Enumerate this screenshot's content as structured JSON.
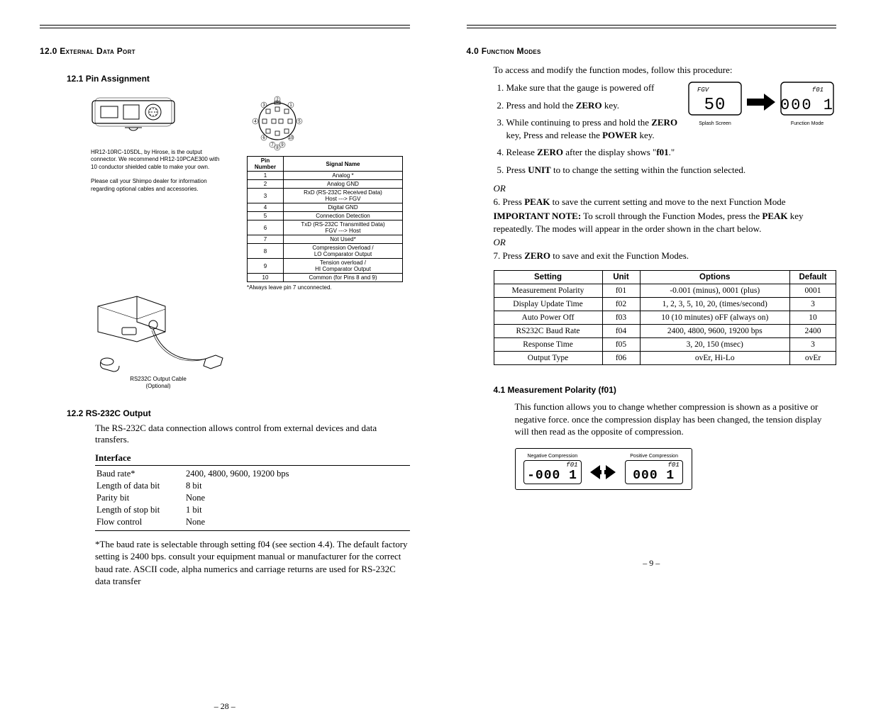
{
  "left": {
    "heading": "12.0 External Data Port",
    "sub1": "12.1 Pin Assignment",
    "connector_note1": "HR12-10RC-10SDL, by Hirose, is the output connector. We recommend HR12-10PCAE300 with 10 conductor shielded cable to make your own.",
    "connector_note2": "Please call your Shimpo dealer for information regarding optional cables and accessories.",
    "pin_header": {
      "num": "Pin Number",
      "sig": "Signal Name"
    },
    "pins": [
      {
        "n": "1",
        "s": "Analog *"
      },
      {
        "n": "2",
        "s": "Analog GND"
      },
      {
        "n": "3",
        "s": "RxD (RS-232C Received Data)\nHost ---> FGV"
      },
      {
        "n": "4",
        "s": "Digital GND"
      },
      {
        "n": "5",
        "s": "Connection Detection"
      },
      {
        "n": "6",
        "s": "TxD (RS-232C Transmitted Data)\nFGV ---> Host"
      },
      {
        "n": "7",
        "s": "Not Used*"
      },
      {
        "n": "8",
        "s": "Compression Overload /\nLO Comparator Output"
      },
      {
        "n": "9",
        "s": "Tension overload /\nHI Comparator Output"
      },
      {
        "n": "10",
        "s": "Common (for Pins 8 and 9)"
      }
    ],
    "pin_footnote": "*Always leave pin 7 unconnected.",
    "cable_caption1": "RS232C Output Cable",
    "cable_caption2": "(Optional)",
    "sub2": "12.2 RS-232C Output",
    "rs_intro": "The RS-232C data connection allows control from external devices and data transfers.",
    "iface_title": "Interface",
    "iface_rows": [
      {
        "k": "Baud rate*",
        "v": "2400, 4800, 9600, 19200 bps"
      },
      {
        "k": "Length of data bit",
        "v": "8 bit"
      },
      {
        "k": "Parity bit",
        "v": "None"
      },
      {
        "k": "Length of stop bit",
        "v": "1 bit"
      },
      {
        "k": "Flow control",
        "v": "None"
      }
    ],
    "baud_note": "*The baud rate is selectable through setting f04 (see section 4.4). The default factory setting is 2400 bps. consult your equipment manual or manufacturer for the correct baud rate. ASCII code, alpha numerics and carriage returns are used for RS-232C data transfer",
    "page_num": "– 28 –"
  },
  "right": {
    "heading": "4.0 Function Modes",
    "intro": "To access and modify the function modes, follow this procedure:",
    "steps": [
      "Make sure that the gauge is powered off",
      "Press and hold the <b>ZERO</b> key.",
      "While continuing to press and hold the <b>ZERO</b> key, Press and release the <b>POWER</b> key.",
      "Release <b>ZERO</b> after the display shows \"<b>f01</b>.\"",
      "Press <b>UNIT</b> to to change the setting within the function selected."
    ],
    "or": "OR",
    "step6": "6. Press <b>PEAK</b> to save the current setting and move to the next Function Mode",
    "important": "<b>IMPORTANT NOTE:</b> To scroll through the Function Modes, press the <b>PEAK</b> key repeatedly. The modes will appear in the order shown in the chart below.",
    "step7": "7. Press <b>ZERO</b> to save and exit the Function Modes.",
    "table_header": {
      "setting": "Setting",
      "unit": "Unit",
      "options": "Options",
      "default": "Default"
    },
    "table_rows": [
      {
        "s": "Measurement Polarity",
        "u": "f01",
        "o": "-0.001 (minus), 0001 (plus)",
        "d": "0001"
      },
      {
        "s": "Display Update Time",
        "u": "f02",
        "o": "1, 2, 3, 5, 10, 20, (times/second)",
        "d": "3"
      },
      {
        "s": "Auto Power Off",
        "u": "f03",
        "o": "10 (10 minutes) oFF (always on)",
        "d": "10"
      },
      {
        "s": "RS232C Baud Rate",
        "u": "f04",
        "o": "2400, 4800, 9600, 19200 bps",
        "d": "2400"
      },
      {
        "s": "Response Time",
        "u": "f05",
        "o": "3, 20, 150 (msec)",
        "d": "3"
      },
      {
        "s": "Output Type",
        "u": "f06",
        "o": "ovEr, Hi-Lo",
        "d": "ovEr"
      }
    ],
    "sub41": "4.1   Measurement Polarity (f01)",
    "sub41_body": "This function allows you to change whether compression is shown as a positive or negative force. once the compression display has been changed, the tension display will then read as the opposite of compression.",
    "polarity": {
      "neg_title": "Negative Compression",
      "pos_title": "Positive Compression",
      "label": "f01",
      "neg_val": "-000 1",
      "pos_val": "000 1"
    },
    "lcd": {
      "splash_top": "FGV",
      "splash_val": "50",
      "splash_caption": "Splash Screen",
      "fm_top": "f01",
      "fm_val": "000 1",
      "fm_caption": "Function Mode"
    },
    "page_num": "– 9 –"
  }
}
